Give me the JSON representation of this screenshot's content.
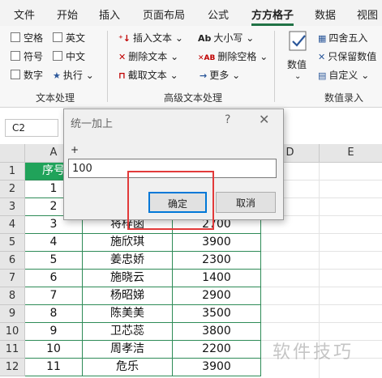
{
  "tabs": [
    "文件",
    "开始",
    "插入",
    "页面布局",
    "公式",
    "方方格子",
    "数据",
    "视图"
  ],
  "active_tab": "方方格子",
  "ribbon": {
    "text_group": {
      "label": "文本处理",
      "checks": [
        "空格",
        "英文",
        "符号",
        "中文",
        "数字"
      ],
      "execute": "执行",
      "execute_arrow": "⌄"
    },
    "adv_group": {
      "label": "高级文本处理",
      "insert_text": "插入文本",
      "delete_text": "删除文本",
      "extract_text": "截取文本",
      "case": "大小写",
      "delete_space": "删除空格",
      "more": "更多",
      "arrow": "⌄"
    },
    "num_group": {
      "label": "数值录入",
      "value_btn": "数值",
      "round": "四舍五入",
      "keep_value": "只保留数值",
      "custom": "自定义"
    }
  },
  "formula_bar": {
    "name_box": "C2"
  },
  "grid": {
    "columns": [
      "A",
      "B",
      "C",
      "D",
      "E"
    ],
    "rows": [
      "1",
      "2",
      "3",
      "4",
      "5",
      "6",
      "7",
      "8",
      "9",
      "10",
      "11",
      "12"
    ],
    "header_row": [
      "序号",
      "",
      ""
    ],
    "data": [
      [
        "1",
        "",
        ""
      ],
      [
        "2",
        "",
        ""
      ],
      [
        "3",
        "将梓函",
        "2700"
      ],
      [
        "4",
        "施欣琪",
        "3900"
      ],
      [
        "5",
        "姜忠娇",
        "2300"
      ],
      [
        "6",
        "施晓云",
        "1400"
      ],
      [
        "7",
        "杨昭娣",
        "2900"
      ],
      [
        "8",
        "陈美美",
        "3500"
      ],
      [
        "9",
        "卫芯蕊",
        "3800"
      ],
      [
        "10",
        "周孝洁",
        "2200"
      ],
      [
        "11",
        "危乐",
        "3900"
      ]
    ]
  },
  "dialog": {
    "title": "统一加上",
    "help": "?",
    "close": "✕",
    "prompt": "+",
    "value": "100",
    "ok": "确定",
    "cancel": "取消"
  },
  "watermark": "软件技巧"
}
